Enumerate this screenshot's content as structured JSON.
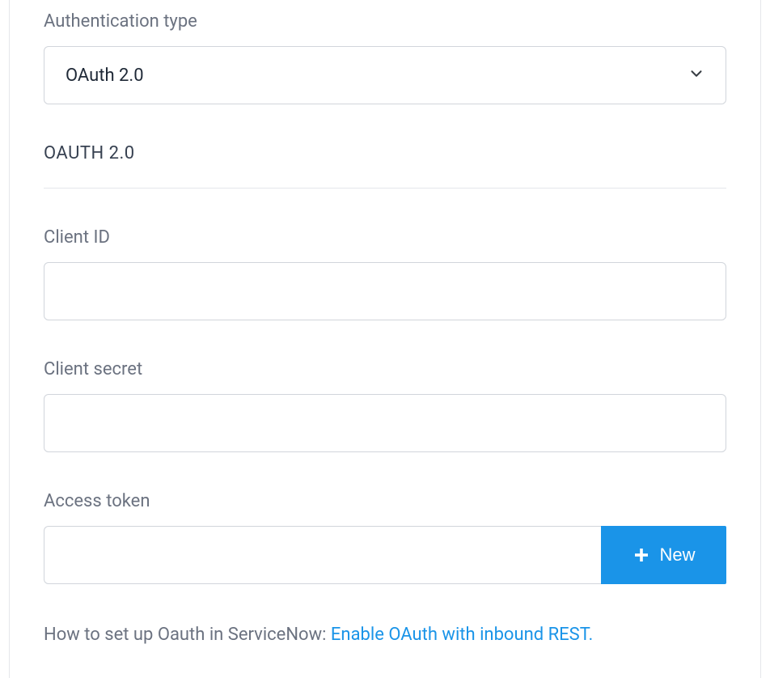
{
  "auth": {
    "type_label": "Authentication type",
    "type_value": "OAuth 2.0"
  },
  "oauth": {
    "section_heading": "OAUTH 2.0",
    "client_id_label": "Client ID",
    "client_id_value": "",
    "client_secret_label": "Client secret",
    "client_secret_value": "",
    "access_token_label": "Access token",
    "access_token_value": "",
    "new_button_label": "New"
  },
  "help": {
    "prefix": "How to set up Oauth in ServiceNow: ",
    "link_text": "Enable OAuth with inbound REST."
  }
}
